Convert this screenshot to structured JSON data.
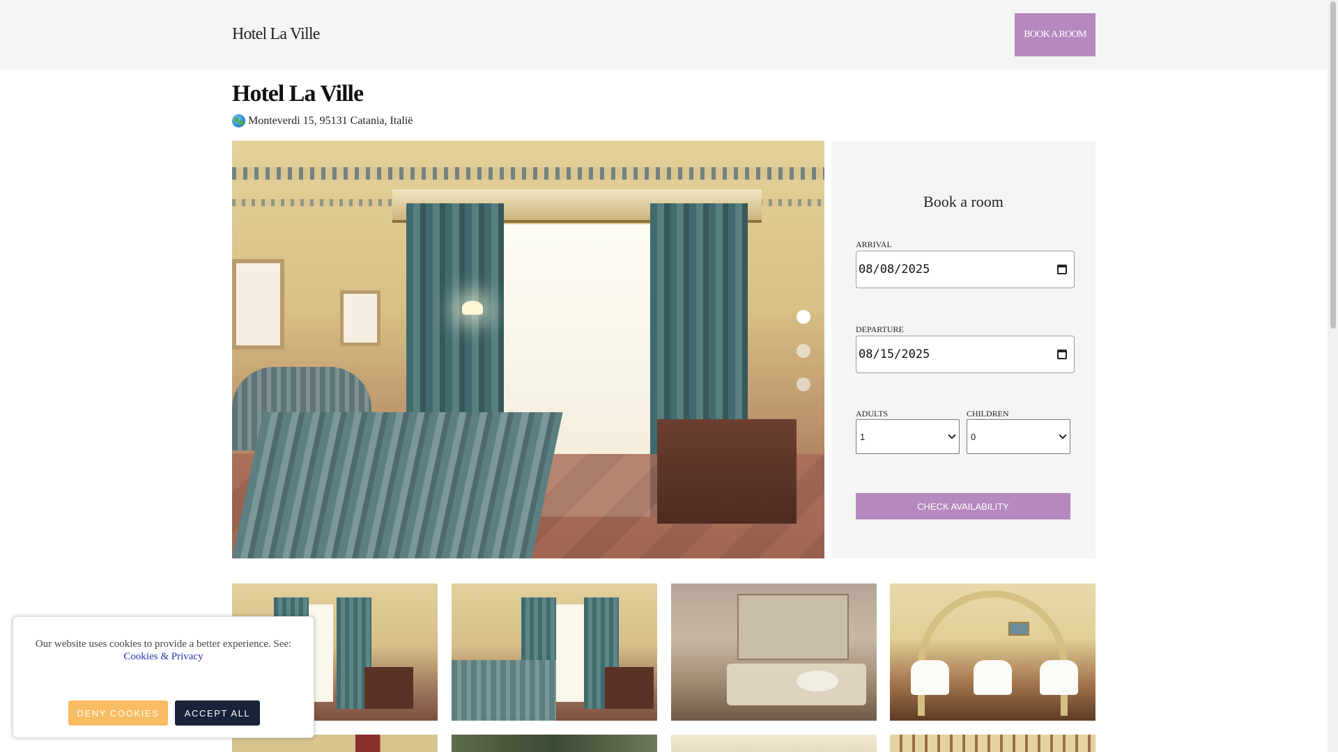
{
  "header": {
    "brand": "Hotel La Ville",
    "book_button": "BOOK A ROOM",
    "accent_color": "#b588bf",
    "background_color": "#f5f5f5"
  },
  "hotel": {
    "name": "Hotel La Ville",
    "address": "Monteverdi 15, 95131 Catania, Italië",
    "address_icon": "globe-icon"
  },
  "carousel": {
    "slides": 3,
    "active_slide": 1
  },
  "booking": {
    "heading": "Book a room",
    "arrival_label": "ARRIVAL",
    "arrival_value": "08/08/2025",
    "departure_label": "DEPARTURE",
    "departure_value": "08/15/2025",
    "adults_label": "ADULTS",
    "adults_value": "1",
    "children_label": "CHILDREN",
    "children_value": "0",
    "check_button": "CHECK AVAILABILITY"
  },
  "gallery": {
    "thumbnails": [
      "room-photo",
      "room-photo",
      "bathroom-photo",
      "breakfast-room-photo"
    ]
  },
  "cookie_banner": {
    "text": "Our website uses cookies to provide a better experience. See:",
    "link": "Cookies & Privacy",
    "deny_button": "DENY COOKIES",
    "accept_button": "ACCEPT ALL",
    "deny_color": "#f8bc63",
    "accept_color": "#172339"
  }
}
